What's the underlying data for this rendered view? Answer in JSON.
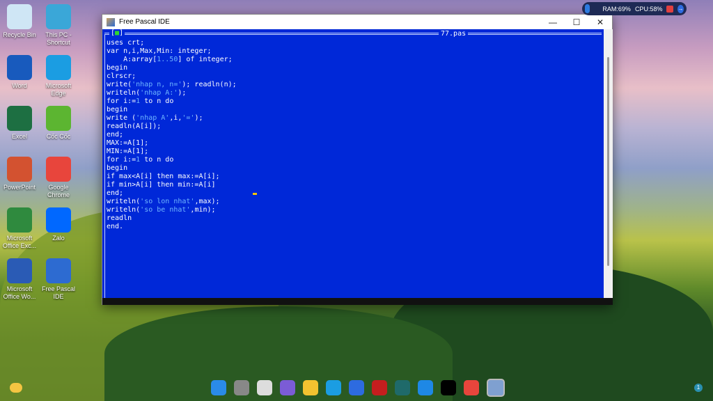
{
  "desktop": {
    "icons": [
      {
        "label": "Recycle Bin",
        "icon": "recycle-bin-icon",
        "color": "#cfe6f5"
      },
      {
        "label": "This PC - Shortcut",
        "icon": "monitor-icon",
        "color": "#3aa7d8"
      },
      {
        "label": "Word",
        "icon": "word-icon",
        "color": "#185abd"
      },
      {
        "label": "Microsoft Edge",
        "icon": "edge-icon",
        "color": "#1b9de2"
      },
      {
        "label": "Excel",
        "icon": "excel-icon",
        "color": "#1d6f42"
      },
      {
        "label": "Cốc Cốc",
        "icon": "coccoc-icon",
        "color": "#5cb531"
      },
      {
        "label": "PowerPoint",
        "icon": "powerpoint-icon",
        "color": "#d35230"
      },
      {
        "label": "Google Chrome",
        "icon": "chrome-icon",
        "color": "#e8453c"
      },
      {
        "label": "Microsoft Office Exc...",
        "icon": "office-excel-icon",
        "color": "#2f8a3e"
      },
      {
        "label": "Zalo",
        "icon": "zalo-icon",
        "color": "#0068ff"
      },
      {
        "label": "Microsoft Office Wo...",
        "icon": "office-word-icon",
        "color": "#2a5bb5"
      },
      {
        "label": "Free Pascal IDE",
        "icon": "fpc-icon",
        "color": "#2d6bd1"
      }
    ]
  },
  "window": {
    "title": "Free Pascal IDE",
    "minimize": "—",
    "maximize": "☐",
    "close": "✕"
  },
  "editor": {
    "close_box": "■",
    "file_name": "77.pas",
    "lines": [
      "uses crt;",
      "var n,i,Max,Min: integer;",
      "    A:array[1..50] of integer;",
      "begin",
      "clrscr;",
      "write('nhap n, n='); readln(n);",
      "writeln('nhap A:');",
      "for i:=1 to n do",
      "begin",
      "write ('nhap A',i,'=');",
      "readln(A[i]);",
      "end;",
      "MAX:=A[1];",
      "MIN:=A[1];",
      "for i:=1 to n do",
      "begin",
      "if max<A[i] then max:=A[i];",
      "if min>A[i] then min:=A[i]",
      "end;",
      "writeln('so lon nhat',max);",
      "writeln('so be nhat',min);",
      "readln",
      "end."
    ]
  },
  "widget": {
    "ram": "RAM:69%",
    "cpu": "CPU:58%"
  },
  "taskbar": {
    "items": [
      "start",
      "search",
      "task-view",
      "meet",
      "file-explorer",
      "edge",
      "store",
      "app-red",
      "app-download",
      "ccleaner",
      "tiktok",
      "chrome",
      "free-pascal"
    ],
    "notification_count": "1"
  }
}
